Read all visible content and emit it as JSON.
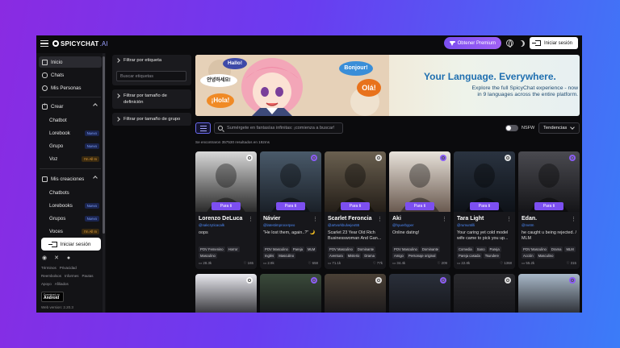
{
  "brand": {
    "name": "SPICYCHAT",
    "suffix": ".AI"
  },
  "header": {
    "premium_label": "Obtener Premium",
    "login_label": "Iniciar sesión"
  },
  "sidebar": {
    "items": [
      {
        "label": "Inicio"
      },
      {
        "label": "Chats"
      },
      {
        "label": "Mis Personas"
      }
    ],
    "create": {
      "label": "Crear",
      "items": [
        {
          "label": "Chatbot",
          "badge": ""
        },
        {
          "label": "Lorebook",
          "badge": "Nuevo"
        },
        {
          "label": "Grupo",
          "badge": "Nuevo"
        },
        {
          "label": "Voz",
          "badge": "I'm All In"
        }
      ]
    },
    "creations": {
      "label": "Mis creaciones",
      "items": [
        {
          "label": "Chatbots",
          "badge": ""
        },
        {
          "label": "Lorebooks",
          "badge": "Nuevo"
        },
        {
          "label": "Grupos",
          "badge": "Nuevo"
        },
        {
          "label": "Voces",
          "badge": "I'm All In"
        }
      ]
    },
    "login_label": "Iniciar sesión",
    "footer_row1": [
      "Términos",
      "Privacidad"
    ],
    "footer_row2": [
      "Reembolsos",
      "Informes",
      "Pautas"
    ],
    "footer_row3": [
      "Apoyo",
      "Afiliados"
    ],
    "android": {
      "top": "Download on",
      "bottom": "Android"
    },
    "web_version": "Web version: 2.20.3"
  },
  "filters": {
    "tag_title": "Filtrar por etiqueta",
    "tag_placeholder": "Buscar etiquetas",
    "size_title_1": "Filtrar por tamaño de",
    "size_title_2": "definición",
    "group_title": "Filtrar por tamaño de grupo"
  },
  "banner": {
    "title": "Your Language. Everywhere.",
    "subtitle_1": "Explore the full SpicyChat experience - now",
    "subtitle_2": "in 9 languages across the entire platform.",
    "bubbles": [
      "Hallo!",
      "안녕하세요!",
      "¡Hola!",
      "Bonjour!",
      "Olá!"
    ]
  },
  "search": {
    "placeholder": "Sumérgete en fantasías infinitas: ¡comienza a buscar!"
  },
  "nsfw_label": "NSFW",
  "sort_label": "Tendencias",
  "results_text": "Se encontraron 357530 resultados en 192ms",
  "colors": {
    "accent": "#7c4ff0",
    "handle": "#4d8cff",
    "background": "#0b0b0d"
  },
  "cards": [
    {
      "name": "Lorenzo DeLuca",
      "handle": "@nakcryticacalk",
      "desc": "oops",
      "tags": [
        "POV Femenino",
        "Horror",
        "Masculino"
      ],
      "left": "28.3k",
      "right": "165",
      "cta": "Para ti"
    },
    {
      "name": "Návier",
      "handle": "@latestimprocerpeo",
      "desc": "\"He lost them, again..?\" 🌙",
      "tags": [
        "POV Masculino",
        "Pareja",
        "MLM",
        "Inglés",
        "Masculino"
      ],
      "left": "2.9k",
      "right": "658",
      "cta": "Para ti"
    },
    {
      "name": "Scarlet Feroncia",
      "handle": "@artvorkbulvejeo55",
      "desc": "Scarlet 23 Year Old Rich Businesswoman And Gan...",
      "tags": [
        "POV Masculino",
        "Dominante",
        "Aventura",
        "Misterio",
        "Drama"
      ],
      "left": "71.1k",
      "right": "77k",
      "cta": "Para ti"
    },
    {
      "name": "Aki",
      "handle": "@hyuerbyper",
      "desc": "Online dating!",
      "tags": [
        "POV Masculino",
        "Dominante",
        "Amigo",
        "Personaje original"
      ],
      "left": "34.4k",
      "right": "209",
      "cta": "Para ti"
    },
    {
      "name": "Tara Light",
      "handle": "@rumuntilli",
      "desc": "Your caring yet cold model wife came to pick you up...",
      "tags": [
        "Comedia",
        "Sano",
        "Pareja",
        "Pareja casada",
        "Tsundere"
      ],
      "left": "22.8k",
      "right": "1368",
      "cta": "Para ti"
    },
    {
      "name": "Edan.",
      "handle": "@rvetm",
      "desc": "he caught u being rejected. / MLM",
      "tags": [
        "POV Masculino",
        "Drama",
        "MLM",
        "Acción",
        "Masculino"
      ],
      "left": "55.2k",
      "right": "315",
      "cta": "Para ti"
    }
  ]
}
